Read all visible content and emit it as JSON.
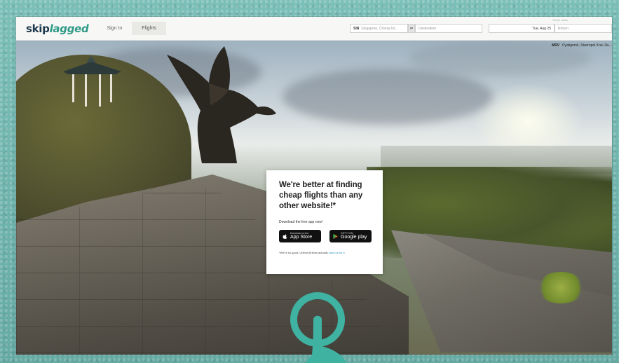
{
  "header": {
    "logo_part1": "skip",
    "logo_part2": "lagged",
    "nav_signin": "Sign In",
    "nav_flights": "Flights",
    "from_code": "SIN",
    "from_text": "Singapore, Changi Int...",
    "swap_label": "⇄",
    "to_placeholder": "Destination",
    "date_label": "Select dates",
    "depart_date": "Tue, Aug 25",
    "return_placeholder": "Return"
  },
  "location_tag": {
    "code": "MRV",
    "place": "Pyatigorsk, Stavropol Krai, Ru..."
  },
  "card": {
    "headline": "We're better at finding cheap flights than any other website!*",
    "subline": "Download the free app now!",
    "appstore_small": "Download on the",
    "appstore_big": "App Store",
    "googleplay_small": "GET IT ON",
    "googleplay_big": "Google play",
    "disclaimer_text": "*We're so good, United Airlines actually",
    "disclaimer_link": "sued us for it"
  },
  "colors": {
    "frame": "#6fb3ad",
    "logo_dark": "#1f3a4d",
    "logo_accent": "#2f9a87",
    "link": "#2a8fbd",
    "pointer": "#3fb2a2"
  },
  "icons": {
    "appstore": "apple-icon",
    "googleplay": "google-play-icon",
    "pointer": "hand-pointer-icon"
  }
}
